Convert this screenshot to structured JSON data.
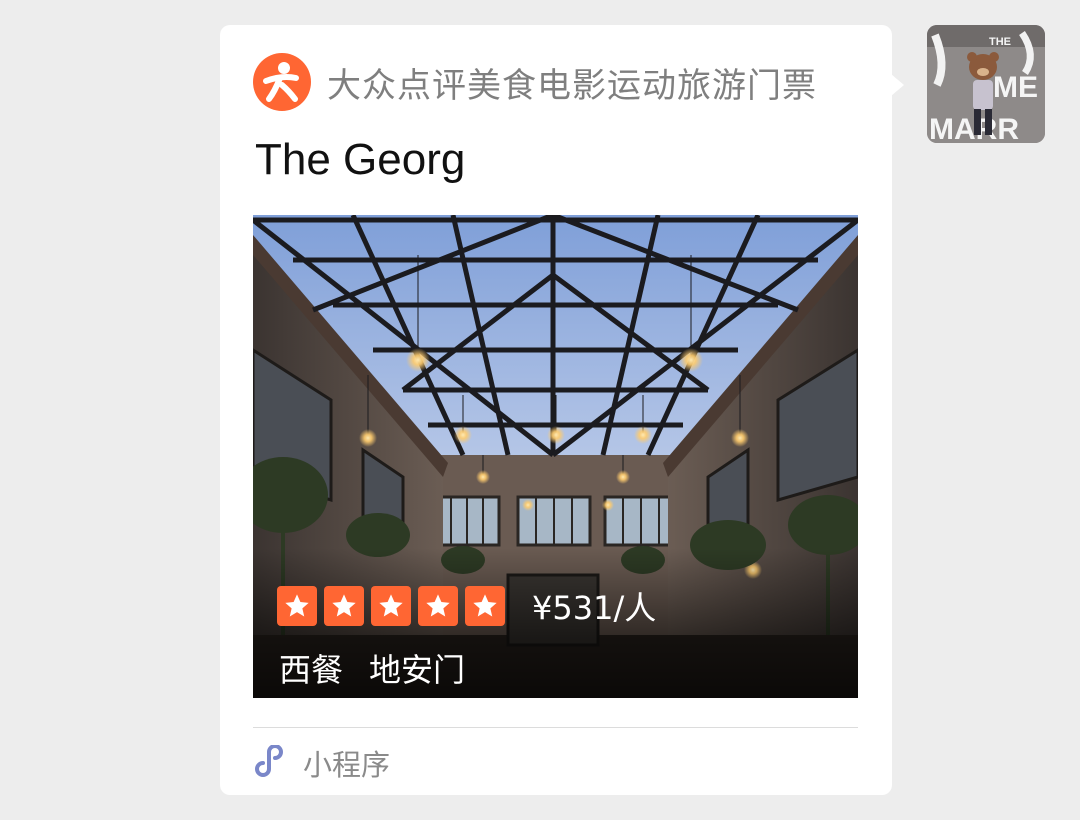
{
  "card": {
    "app_name": "大众点评美食电影运动旅游门票",
    "logo_icon": "dianping-logo-icon",
    "title": "The Georg",
    "rating": {
      "stars": 5,
      "max": 5,
      "star_icon": "star-icon"
    },
    "price": "¥531/人",
    "tags": [
      "西餐",
      "地安门"
    ],
    "footer": {
      "icon": "mini-program-icon",
      "label": "小程序"
    }
  },
  "avatar": {
    "text_top": "THE",
    "text_mid": "ME",
    "text_bottom": "MARR"
  },
  "colors": {
    "accent": "#ff6633",
    "background": "#ededed",
    "card": "#ffffff",
    "mini_program_icon": "#7a87c9",
    "muted_text": "#7f7f7f"
  }
}
